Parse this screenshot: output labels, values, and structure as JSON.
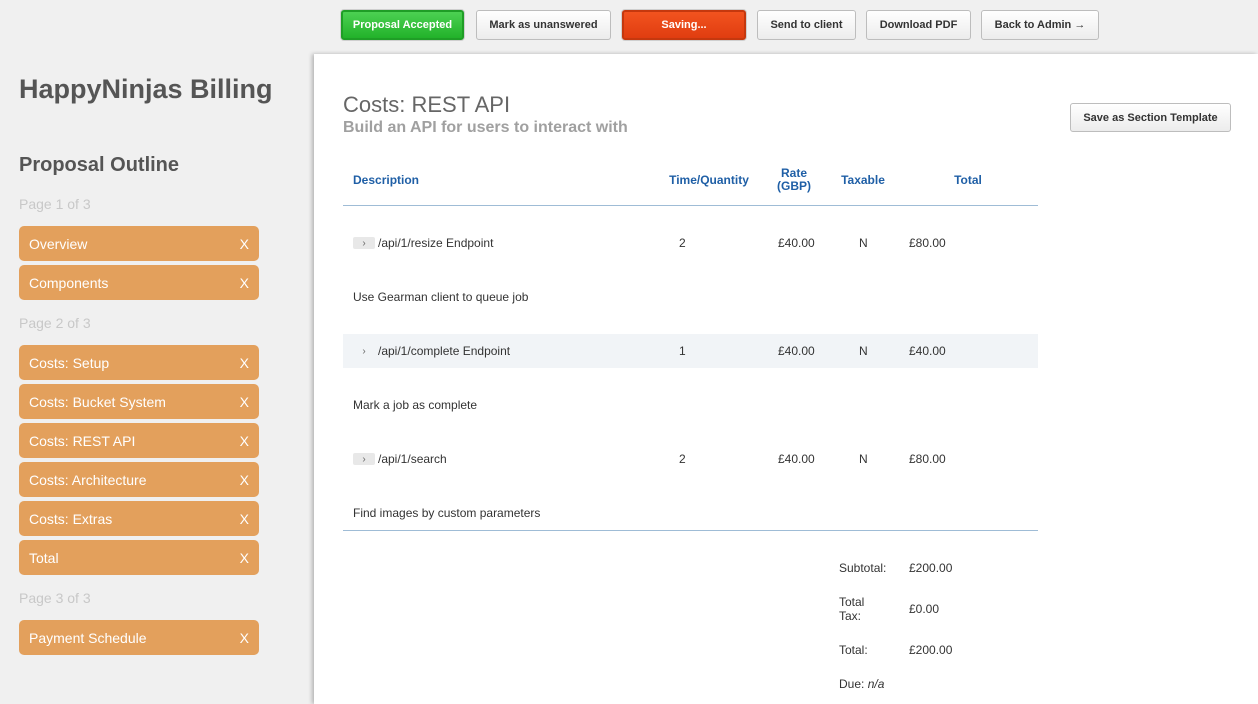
{
  "toolbar": {
    "proposal_accepted": "Proposal Accepted",
    "mark_unanswered": "Mark as unanswered",
    "saving": "Saving...",
    "send_to_client": "Send to client",
    "download_pdf": "Download PDF",
    "back_to_admin": "Back to Admin →"
  },
  "sidebar": {
    "brand": "HappyNinjas Billing",
    "outline_title": "Proposal Outline",
    "pages": [
      {
        "label": "Page 1 of 3",
        "items": [
          "Overview",
          "Components"
        ]
      },
      {
        "label": "Page 2 of 3",
        "items": [
          "Costs: Setup",
          "Costs: Bucket System",
          "Costs: REST API",
          "Costs: Architecture",
          "Costs: Extras",
          "Total"
        ]
      },
      {
        "label": "Page 3 of 3",
        "items": [
          "Payment Schedule"
        ]
      }
    ],
    "remove_glyph": "X"
  },
  "section": {
    "title": "Costs: REST API",
    "subtitle": "Build an API for users to interact with",
    "template_button": "Save as Section Template"
  },
  "table": {
    "headers": {
      "description": "Description",
      "time_quantity": "Time/Quantity",
      "rate_line1": "Rate",
      "rate_line2": "(GBP)",
      "taxable": "Taxable",
      "total": "Total"
    },
    "expander_glyph": "›",
    "rows": [
      {
        "description": "/api/1/resize Endpoint",
        "quantity": "2",
        "rate": "£40.00",
        "taxable": "N",
        "total": "£80.00",
        "note": "Use Gearman client to queue job"
      },
      {
        "description": "/api/1/complete Endpoint",
        "quantity": "1",
        "rate": "£40.00",
        "taxable": "N",
        "total": "£40.00",
        "note": "Mark a job as complete"
      },
      {
        "description": "/api/1/search",
        "quantity": "2",
        "rate": "£40.00",
        "taxable": "N",
        "total": "£80.00",
        "note": "Find images by custom parameters"
      }
    ]
  },
  "summary": {
    "subtotal_label": "Subtotal:",
    "subtotal_value": "£200.00",
    "tax_label_line1": "Total",
    "tax_label_line2": "Tax:",
    "tax_value": "£0.00",
    "total_label": "Total:",
    "total_value": "£200.00",
    "due_label": "Due:",
    "due_value": "n/a"
  },
  "colors": {
    "accepted_green": "#2bbf33",
    "saving_red": "#e8461a",
    "nav_orange": "#e3a05c",
    "header_blue": "#1f5fa6"
  }
}
